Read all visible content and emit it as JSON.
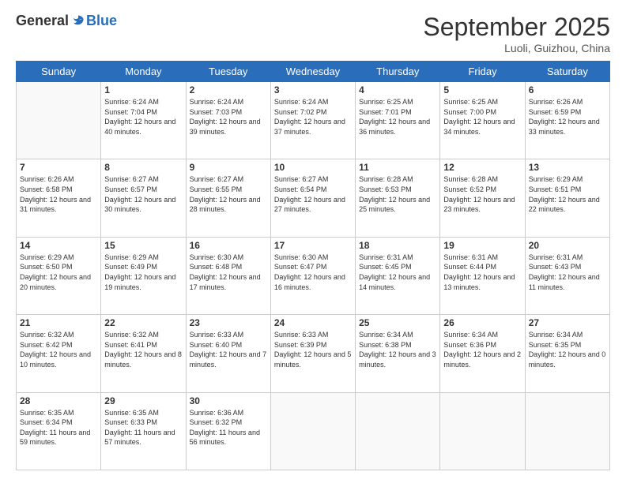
{
  "logo": {
    "general": "General",
    "blue": "Blue"
  },
  "header": {
    "month": "September 2025",
    "location": "Luoli, Guizhou, China"
  },
  "days_of_week": [
    "Sunday",
    "Monday",
    "Tuesday",
    "Wednesday",
    "Thursday",
    "Friday",
    "Saturday"
  ],
  "weeks": [
    [
      {
        "day": "",
        "info": ""
      },
      {
        "day": "1",
        "info": "Sunrise: 6:24 AM\nSunset: 7:04 PM\nDaylight: 12 hours and 40 minutes."
      },
      {
        "day": "2",
        "info": "Sunrise: 6:24 AM\nSunset: 7:03 PM\nDaylight: 12 hours and 39 minutes."
      },
      {
        "day": "3",
        "info": "Sunrise: 6:24 AM\nSunset: 7:02 PM\nDaylight: 12 hours and 37 minutes."
      },
      {
        "day": "4",
        "info": "Sunrise: 6:25 AM\nSunset: 7:01 PM\nDaylight: 12 hours and 36 minutes."
      },
      {
        "day": "5",
        "info": "Sunrise: 6:25 AM\nSunset: 7:00 PM\nDaylight: 12 hours and 34 minutes."
      },
      {
        "day": "6",
        "info": "Sunrise: 6:26 AM\nSunset: 6:59 PM\nDaylight: 12 hours and 33 minutes."
      }
    ],
    [
      {
        "day": "7",
        "info": "Sunrise: 6:26 AM\nSunset: 6:58 PM\nDaylight: 12 hours and 31 minutes."
      },
      {
        "day": "8",
        "info": "Sunrise: 6:27 AM\nSunset: 6:57 PM\nDaylight: 12 hours and 30 minutes."
      },
      {
        "day": "9",
        "info": "Sunrise: 6:27 AM\nSunset: 6:55 PM\nDaylight: 12 hours and 28 minutes."
      },
      {
        "day": "10",
        "info": "Sunrise: 6:27 AM\nSunset: 6:54 PM\nDaylight: 12 hours and 27 minutes."
      },
      {
        "day": "11",
        "info": "Sunrise: 6:28 AM\nSunset: 6:53 PM\nDaylight: 12 hours and 25 minutes."
      },
      {
        "day": "12",
        "info": "Sunrise: 6:28 AM\nSunset: 6:52 PM\nDaylight: 12 hours and 23 minutes."
      },
      {
        "day": "13",
        "info": "Sunrise: 6:29 AM\nSunset: 6:51 PM\nDaylight: 12 hours and 22 minutes."
      }
    ],
    [
      {
        "day": "14",
        "info": "Sunrise: 6:29 AM\nSunset: 6:50 PM\nDaylight: 12 hours and 20 minutes."
      },
      {
        "day": "15",
        "info": "Sunrise: 6:29 AM\nSunset: 6:49 PM\nDaylight: 12 hours and 19 minutes."
      },
      {
        "day": "16",
        "info": "Sunrise: 6:30 AM\nSunset: 6:48 PM\nDaylight: 12 hours and 17 minutes."
      },
      {
        "day": "17",
        "info": "Sunrise: 6:30 AM\nSunset: 6:47 PM\nDaylight: 12 hours and 16 minutes."
      },
      {
        "day": "18",
        "info": "Sunrise: 6:31 AM\nSunset: 6:45 PM\nDaylight: 12 hours and 14 minutes."
      },
      {
        "day": "19",
        "info": "Sunrise: 6:31 AM\nSunset: 6:44 PM\nDaylight: 12 hours and 13 minutes."
      },
      {
        "day": "20",
        "info": "Sunrise: 6:31 AM\nSunset: 6:43 PM\nDaylight: 12 hours and 11 minutes."
      }
    ],
    [
      {
        "day": "21",
        "info": "Sunrise: 6:32 AM\nSunset: 6:42 PM\nDaylight: 12 hours and 10 minutes."
      },
      {
        "day": "22",
        "info": "Sunrise: 6:32 AM\nSunset: 6:41 PM\nDaylight: 12 hours and 8 minutes."
      },
      {
        "day": "23",
        "info": "Sunrise: 6:33 AM\nSunset: 6:40 PM\nDaylight: 12 hours and 7 minutes."
      },
      {
        "day": "24",
        "info": "Sunrise: 6:33 AM\nSunset: 6:39 PM\nDaylight: 12 hours and 5 minutes."
      },
      {
        "day": "25",
        "info": "Sunrise: 6:34 AM\nSunset: 6:38 PM\nDaylight: 12 hours and 3 minutes."
      },
      {
        "day": "26",
        "info": "Sunrise: 6:34 AM\nSunset: 6:36 PM\nDaylight: 12 hours and 2 minutes."
      },
      {
        "day": "27",
        "info": "Sunrise: 6:34 AM\nSunset: 6:35 PM\nDaylight: 12 hours and 0 minutes."
      }
    ],
    [
      {
        "day": "28",
        "info": "Sunrise: 6:35 AM\nSunset: 6:34 PM\nDaylight: 11 hours and 59 minutes."
      },
      {
        "day": "29",
        "info": "Sunrise: 6:35 AM\nSunset: 6:33 PM\nDaylight: 11 hours and 57 minutes."
      },
      {
        "day": "30",
        "info": "Sunrise: 6:36 AM\nSunset: 6:32 PM\nDaylight: 11 hours and 56 minutes."
      },
      {
        "day": "",
        "info": ""
      },
      {
        "day": "",
        "info": ""
      },
      {
        "day": "",
        "info": ""
      },
      {
        "day": "",
        "info": ""
      }
    ]
  ]
}
